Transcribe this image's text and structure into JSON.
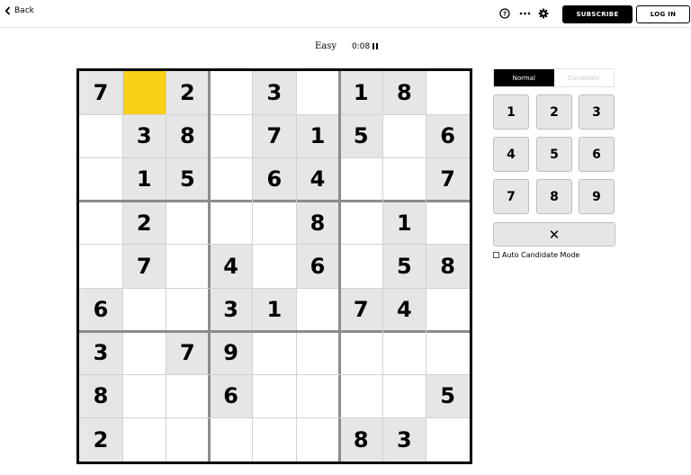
{
  "topbar": {
    "back_label": "Back",
    "icons": [
      "help-icon",
      "more-icon",
      "settings-icon"
    ],
    "subscribe_label": "SUBSCRIBE",
    "login_label": "LOG IN"
  },
  "status": {
    "difficulty": "Easy",
    "timer": "0:08",
    "pause_icon": "pause-icon"
  },
  "colors": {
    "selected": "#f8d114",
    "given_cell": "#e6e6e6",
    "mode_active": "#000000"
  },
  "board": {
    "selected": [
      0,
      1
    ],
    "grid": [
      [
        "7",
        "",
        "2",
        "",
        "3",
        "",
        "1",
        "8",
        ""
      ],
      [
        "",
        "3",
        "8",
        "",
        "7",
        "1",
        "5",
        "",
        "6"
      ],
      [
        "",
        "1",
        "5",
        "",
        "6",
        "4",
        "",
        "",
        "7"
      ],
      [
        "",
        "2",
        "",
        "",
        "",
        "8",
        "",
        "1",
        ""
      ],
      [
        "",
        "7",
        "",
        "4",
        "",
        "6",
        "",
        "5",
        "8"
      ],
      [
        "6",
        "",
        "",
        "3",
        "1",
        "",
        "7",
        "4",
        ""
      ],
      [
        "3",
        "",
        "7",
        "9",
        "",
        "",
        "",
        "",
        ""
      ],
      [
        "8",
        "",
        "",
        "6",
        "",
        "",
        "",
        "",
        "5"
      ],
      [
        "2",
        "",
        "",
        "",
        "",
        "",
        "8",
        "3",
        ""
      ]
    ]
  },
  "controls": {
    "mode_normal": "Normal",
    "mode_candidate": "Candidate",
    "keys": [
      "1",
      "2",
      "3",
      "4",
      "5",
      "6",
      "7",
      "8",
      "9"
    ],
    "erase_label": "✕",
    "auto_candidate_label": "Auto Candidate Mode"
  }
}
